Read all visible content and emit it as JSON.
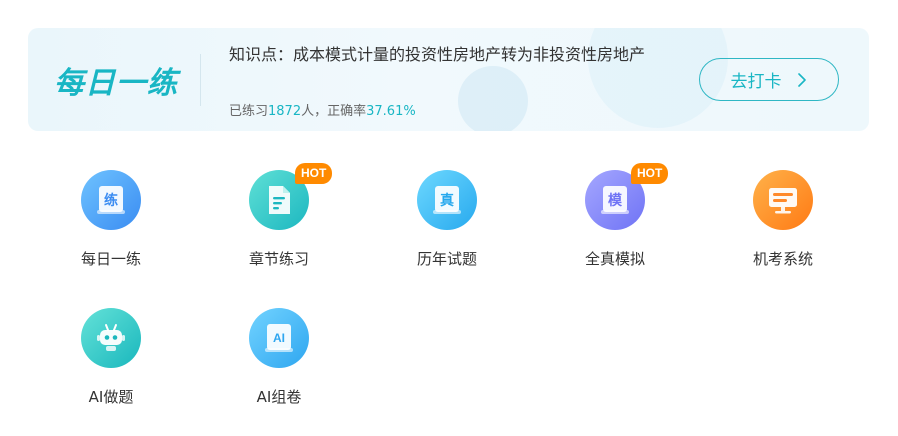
{
  "banner": {
    "title": "每日一练",
    "knowledge_point": "知识点：成本模式计量的投资性房地产转为非投资性房地产",
    "stats_prefix": "已练习",
    "stats_count": "1872",
    "stats_mid": "人，正确率",
    "stats_rate": "37.61%",
    "checkin_label": "去打卡"
  },
  "menu": [
    {
      "label": "每日一练",
      "icon": "practice-book-icon",
      "glyph": "练",
      "hot": false
    },
    {
      "label": "章节练习",
      "icon": "chapter-document-icon",
      "glyph": "",
      "hot": true
    },
    {
      "label": "历年试题",
      "icon": "past-exam-book-icon",
      "glyph": "真",
      "hot": false
    },
    {
      "label": "全真模拟",
      "icon": "mock-exam-book-icon",
      "glyph": "模",
      "hot": true
    },
    {
      "label": "机考系统",
      "icon": "computer-monitor-icon",
      "glyph": "",
      "hot": false
    },
    {
      "label": "AI做题",
      "icon": "robot-icon",
      "glyph": "",
      "hot": false
    },
    {
      "label": "AI组卷",
      "icon": "ai-book-icon",
      "glyph": "AI",
      "hot": false
    }
  ],
  "hot_badge": "HOT",
  "colors": {
    "accent": "#19b6c4",
    "hot": "#ff8a00"
  }
}
